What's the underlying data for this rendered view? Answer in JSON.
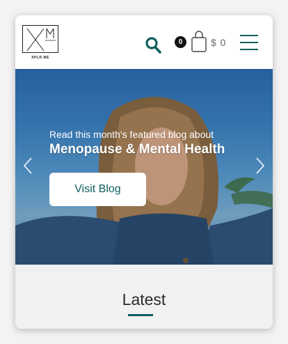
{
  "header": {
    "logo_text": "XPLR ME",
    "logo_mark": "XM",
    "cart_count": "0",
    "cart_total": "$ 0"
  },
  "hero": {
    "kicker": "Read this month's featured blog about",
    "title": "Menopause & Mental Health",
    "cta_label": "Visit Blog"
  },
  "latest": {
    "title": "Latest"
  },
  "colors": {
    "accent": "#0e5f5e",
    "badge": "#111111"
  },
  "icons": [
    "search-icon",
    "shopping-bag-icon",
    "hamburger-menu-icon",
    "chevron-left-icon",
    "chevron-right-icon"
  ]
}
